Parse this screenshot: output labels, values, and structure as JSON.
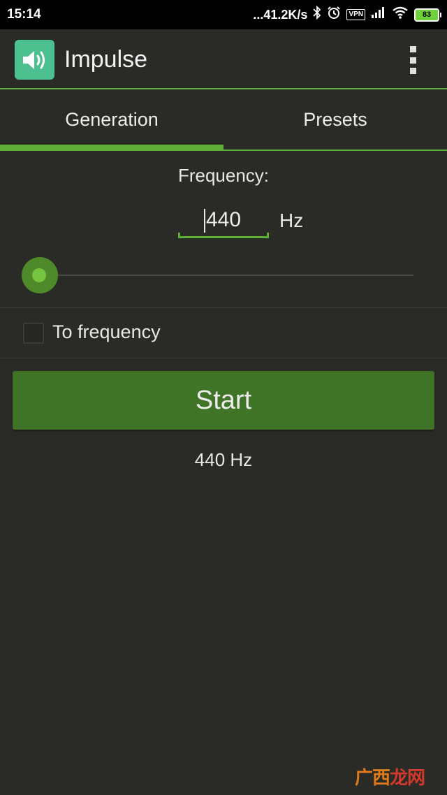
{
  "status_bar": {
    "time": "15:14",
    "net_speed": "...41.2K/s",
    "vpn": "VPN",
    "battery": "83",
    "icons": [
      "bluetooth-icon",
      "alarm-icon",
      "vpn-icon",
      "signal-icon",
      "wifi-icon",
      "battery-icon"
    ]
  },
  "app_bar": {
    "title": "Impulse",
    "icon": "speaker-icon",
    "menu_icon": "overflow-menu-icon"
  },
  "tabs": [
    {
      "label": "Generation",
      "selected": true
    },
    {
      "label": "Presets",
      "selected": false
    }
  ],
  "generation": {
    "frequency_label": "Frequency:",
    "frequency_value": "440",
    "unit": "Hz",
    "slider_level": 0.0,
    "to_frequency_label": "To frequency",
    "to_frequency_checked": false,
    "start_label": "Start",
    "current_frequency": "440 Hz"
  },
  "watermark": {
    "part1": "广西",
    "part2": "龙网"
  },
  "colors": {
    "background": "#2a2a27",
    "accent": "#5fae3a",
    "button": "#3f7326",
    "app_icon": "#4cc08f"
  }
}
